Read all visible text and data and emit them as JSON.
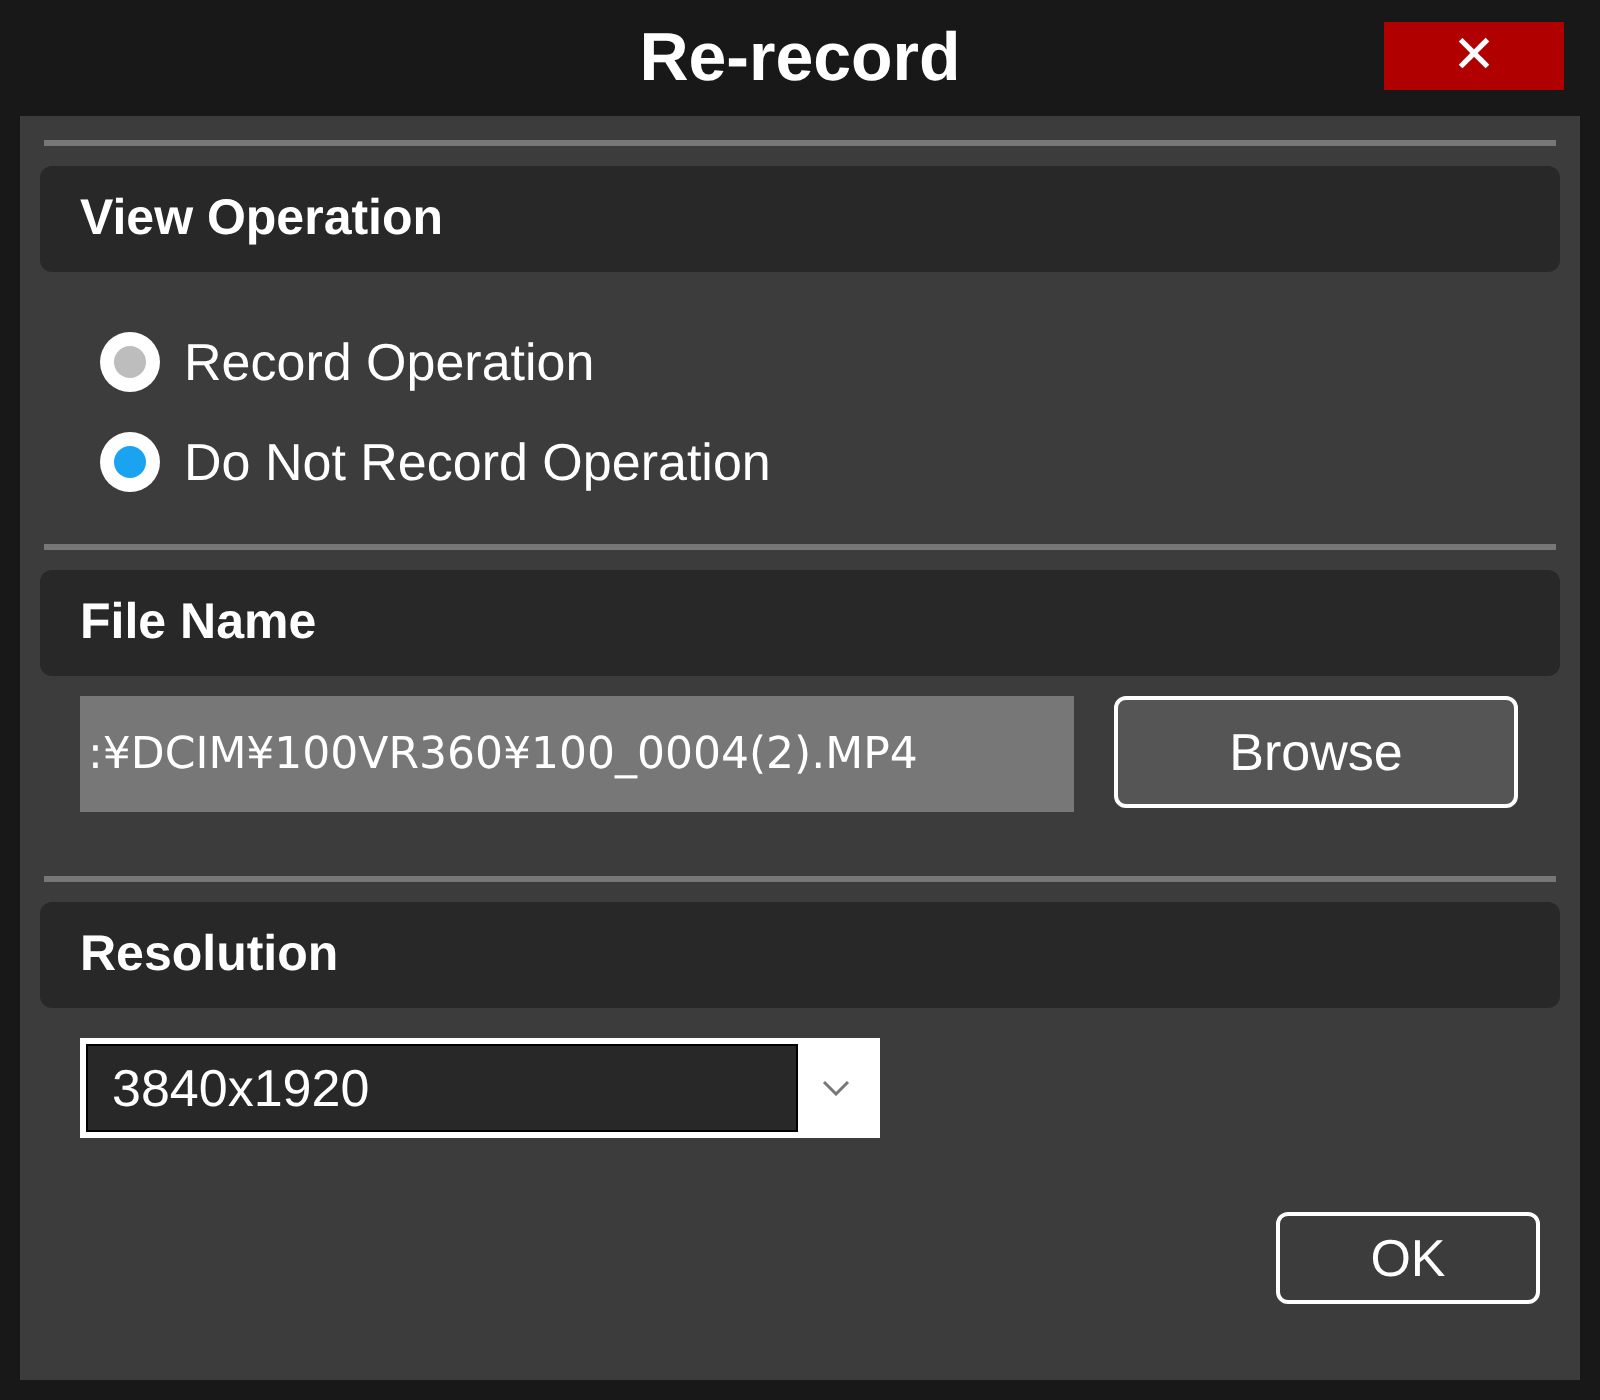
{
  "window": {
    "title": "Re-record",
    "close": "✕"
  },
  "sections": [
    {
      "kind": "radios",
      "title": "View Operation",
      "options": [
        {
          "label": "Record Operation",
          "selected": false
        },
        {
          "label": "Do Not Record Operation",
          "selected": true
        }
      ]
    },
    {
      "kind": "file",
      "title": "File Name",
      "value": ":¥DCIM¥100VR360¥100_0004(2).MP4",
      "button": "Browse"
    },
    {
      "kind": "select",
      "title": "Resolution",
      "value": "3840x1920"
    }
  ],
  "buttons": [
    "OK"
  ]
}
